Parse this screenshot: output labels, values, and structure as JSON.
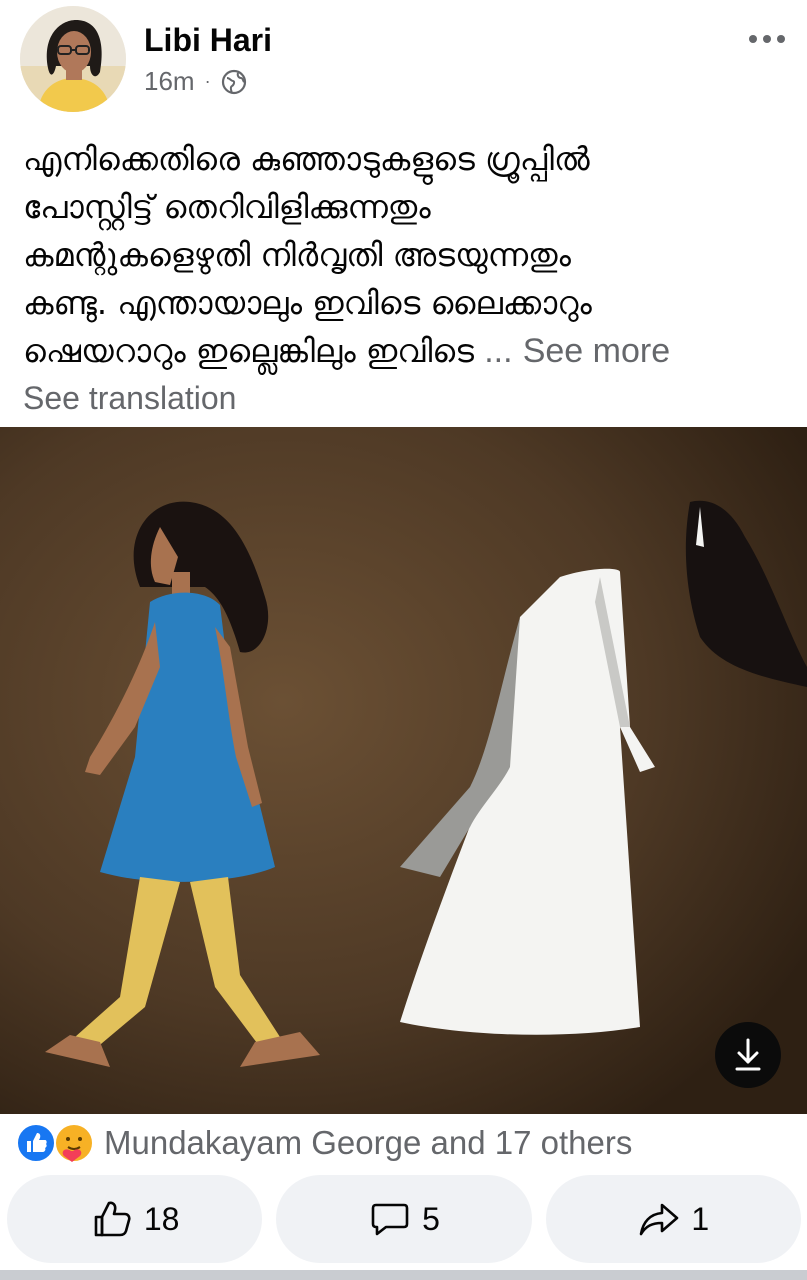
{
  "post": {
    "author": "Libi Hari",
    "time": "16m",
    "separator": "·",
    "privacy_icon": "globe-icon",
    "more_icon": "more-horizontal-icon",
    "text_lines": [
      "എനിക്കെതിരെ കുഞ്ഞാടുകളുടെ ഗ്രൂപ്പിൽ",
      "പോസ്റ്റിട്ട് തെറിവിളിക്കുന്നതും",
      "കമന്റുകളെഴുതി നിർവൃതി അടയുന്നതും",
      "കണ്ടു. എന്തായാലും ഇവിടെ ലൈക്കാറും",
      "ഷെയറാറും ഇല്ലെങ്കിലും ഇവിടെ"
    ],
    "ellipsis": "...",
    "see_more": "See more",
    "see_translation": "See translation",
    "image_download_icon": "download-icon"
  },
  "reactions": {
    "icons": [
      "like-icon",
      "care-icon"
    ],
    "summary": "Mundakayam George and 17 others"
  },
  "actions": {
    "like_count": "18",
    "comment_count": "5",
    "share_count": "1"
  },
  "colors": {
    "secondary_text": "#65676b",
    "like_blue": "#1877f2",
    "button_bg": "#f0f2f5",
    "image_bg": "#4a3623"
  }
}
